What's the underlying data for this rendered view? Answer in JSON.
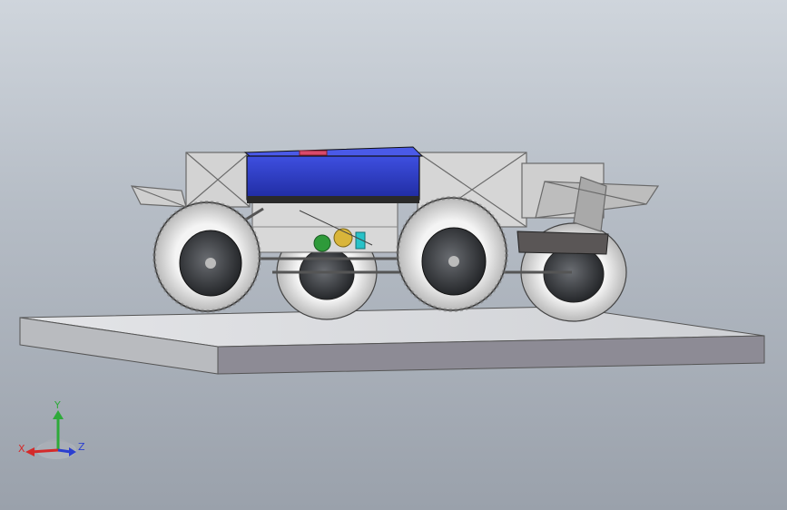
{
  "viewport": {
    "background_top": "#cfd5dc",
    "background_bottom": "#9aa1ab"
  },
  "model": {
    "battery_box_color": "#2f3fc4",
    "frame_color": "#c9c9c9",
    "tire_color": "#efefef",
    "hub_color": "#3a3c40",
    "platform_color": "#d7d9dc",
    "accent_green": "#2e9a3a",
    "accent_yellow": "#d9b53a",
    "accent_cyan": "#28c2c8"
  },
  "triad": {
    "x_label": "X",
    "y_label": "Y",
    "z_label": "Z",
    "x_color": "#d42a2a",
    "y_color": "#2eaa3a",
    "z_color": "#2b3fd0"
  }
}
